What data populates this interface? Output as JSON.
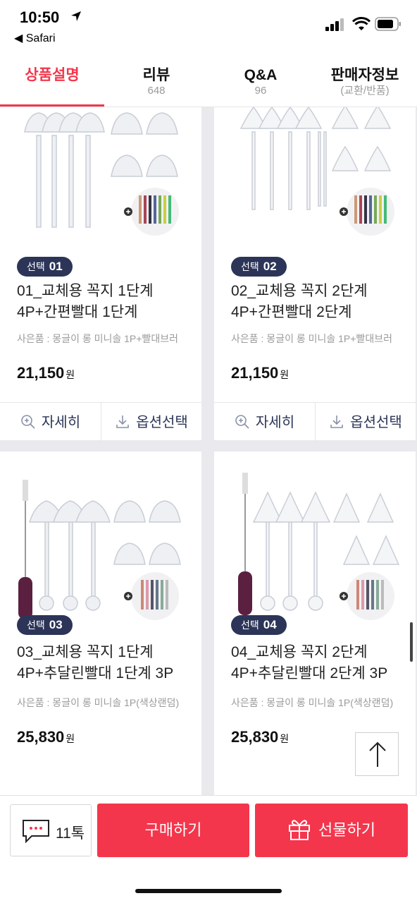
{
  "status": {
    "time": "10:50",
    "back_label": "◀ Safari"
  },
  "tabs": [
    {
      "label": "상품설명",
      "sub": ""
    },
    {
      "label": "리뷰",
      "sub": "648"
    },
    {
      "label": "Q&A",
      "sub": "96"
    },
    {
      "label": "판매자정보",
      "sub": "(교환/반품)"
    }
  ],
  "products": [
    {
      "badge_prefix": "선택",
      "badge_num": "01",
      "name": "01_교체용 꼭지 1단계 4P+간편빨대 1단계",
      "gift": "사은품 : 몽글이 롱 미니솔 1P+빨대브러",
      "price": "21,150",
      "won": "원"
    },
    {
      "badge_prefix": "선택",
      "badge_num": "02",
      "name": "02_교체용 꼭지 2단계 4P+간편빨대 2단계",
      "gift": "사은품 : 몽글이 롱 미니솔 1P+빨대브러",
      "price": "21,150",
      "won": "원"
    },
    {
      "badge_prefix": "선택",
      "badge_num": "03",
      "name": "03_교체용 꼭지 1단계 4P+추달린빨대 1단계 3P",
      "gift": "사은품 : 몽글이 롱 미니솔 1P(색상랜덤)",
      "price": "25,830",
      "won": "원"
    },
    {
      "badge_prefix": "선택",
      "badge_num": "04",
      "name": "04_교체용 꼭지 2단계 4P+추달린빨대 2단계 3P",
      "gift": "사은품 : 몽글이 롱 미니솔 1P(색상랜덤)",
      "price": "25,830",
      "won": "원"
    }
  ],
  "card_actions": {
    "detail": "자세히",
    "option": "옵션선택"
  },
  "bottom": {
    "talk": "11톡",
    "buy": "구매하기",
    "gift": "선물하기"
  },
  "colors": {
    "accent": "#f4364c",
    "badge": "#2c3558"
  },
  "icons": [
    "location-arrow-icon",
    "signal-icon",
    "wifi-icon",
    "battery-icon",
    "zoom-icon",
    "download-icon",
    "chat-icon",
    "gift-icon",
    "arrow-up-icon"
  ]
}
